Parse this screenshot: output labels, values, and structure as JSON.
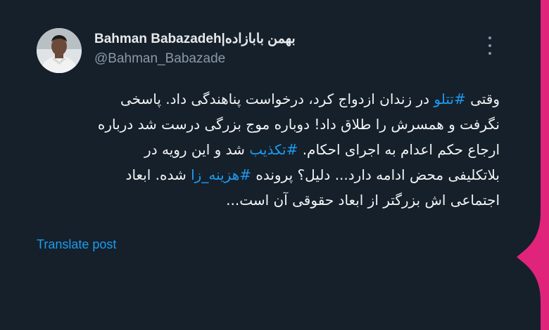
{
  "author": {
    "name": "Bahman Babazadeh|بهمن بابازاده",
    "handle": "@Bahman_Babazade"
  },
  "icons": {
    "more": "more-vertical-icon",
    "avatar": "profile-photo"
  },
  "tweet": {
    "lines": [
      [
        {
          "t": "وقتی "
        },
        {
          "t": "#تتلو",
          "tag": true
        },
        {
          "t": " در زندان ازدواج کرد، درخواست پناهندگی داد. پاسخی"
        }
      ],
      [
        {
          "t": "نگرفت و همسرش را طلاق داد! دوباره موج بزرگی درست شد درباره"
        }
      ],
      [
        {
          "t": "ارجاع حکم اعدام به اجرای احکام. "
        },
        {
          "t": "#تکذیب",
          "tag": true
        },
        {
          "t": " شد و این رویه در"
        }
      ],
      [
        {
          "t": "بلاتکلیفی محض ادامه دارد... دلیل؟ پرونده "
        },
        {
          "t": "#هزینه_زا",
          "tag": true
        },
        {
          "t": " شده. ابعاد"
        }
      ],
      [
        {
          "t": "اجتماعی اش بزرگتر از ابعاد حقوقی آن است..."
        }
      ]
    ]
  },
  "translate_label": "Translate post",
  "colors": {
    "background": "#15202b",
    "text": "#e7e9ea",
    "muted": "#8b98a5",
    "link": "#1d9bf0",
    "accent": "#e0247b"
  }
}
